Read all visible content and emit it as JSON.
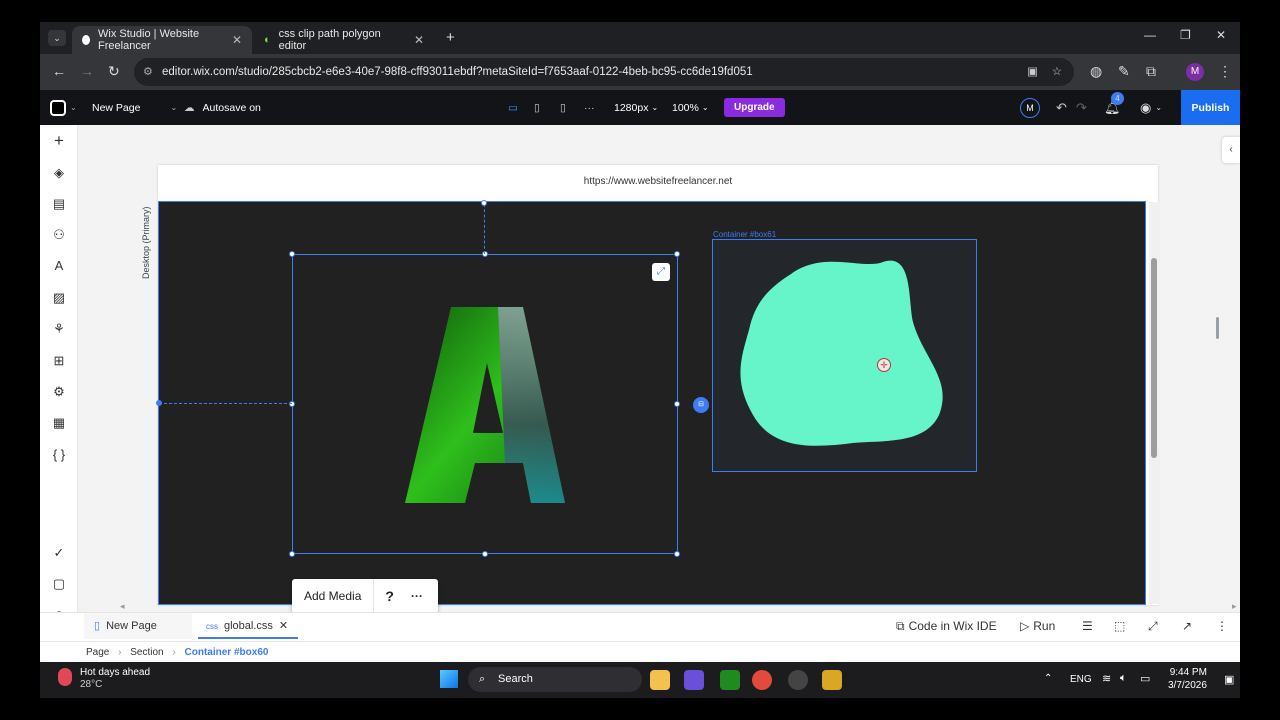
{
  "browser": {
    "tabs": [
      {
        "title": "Wix Studio | Website Freelancer",
        "active": true
      },
      {
        "title": "css clip path polygon editor",
        "active": false
      }
    ],
    "url": "editor.wix.com/studio/285cbcb2-e6e3-40e7-98f8-cff93011ebdf?metaSiteId=f7653aaf-0122-4beb-bc95-cc6de19fd051",
    "profile_initial": "M"
  },
  "wix_toolbar": {
    "page_name": "New Page",
    "autosave": "Autosave on",
    "breakpoint": "1280px",
    "zoom": "100%",
    "upgrade": "Upgrade",
    "user_initial": "M",
    "notifications_count": "4",
    "publish": "Publish"
  },
  "canvas": {
    "site_url": "https://www.websitefreelancer.net",
    "breakpoint_label": "Desktop (Primary)",
    "container_label": "Container #box61",
    "letter": "A",
    "blob_color": "#66f5c8"
  },
  "floating_toolbar": {
    "add_media": "Add Media",
    "help": "?",
    "more": "···"
  },
  "bottom_panel": {
    "tabs": [
      "New Page",
      "global.css"
    ],
    "code_in_ide": "Code in Wix IDE",
    "run": "Run",
    "breadcrumb": [
      "Page",
      "Section",
      "Container #box60"
    ]
  },
  "taskbar": {
    "weather_title": "Hot days ahead",
    "weather_temp": "28°C",
    "search": "Search",
    "lang": "ENG",
    "time": "9:44 PM",
    "date": "3/7/2026"
  }
}
